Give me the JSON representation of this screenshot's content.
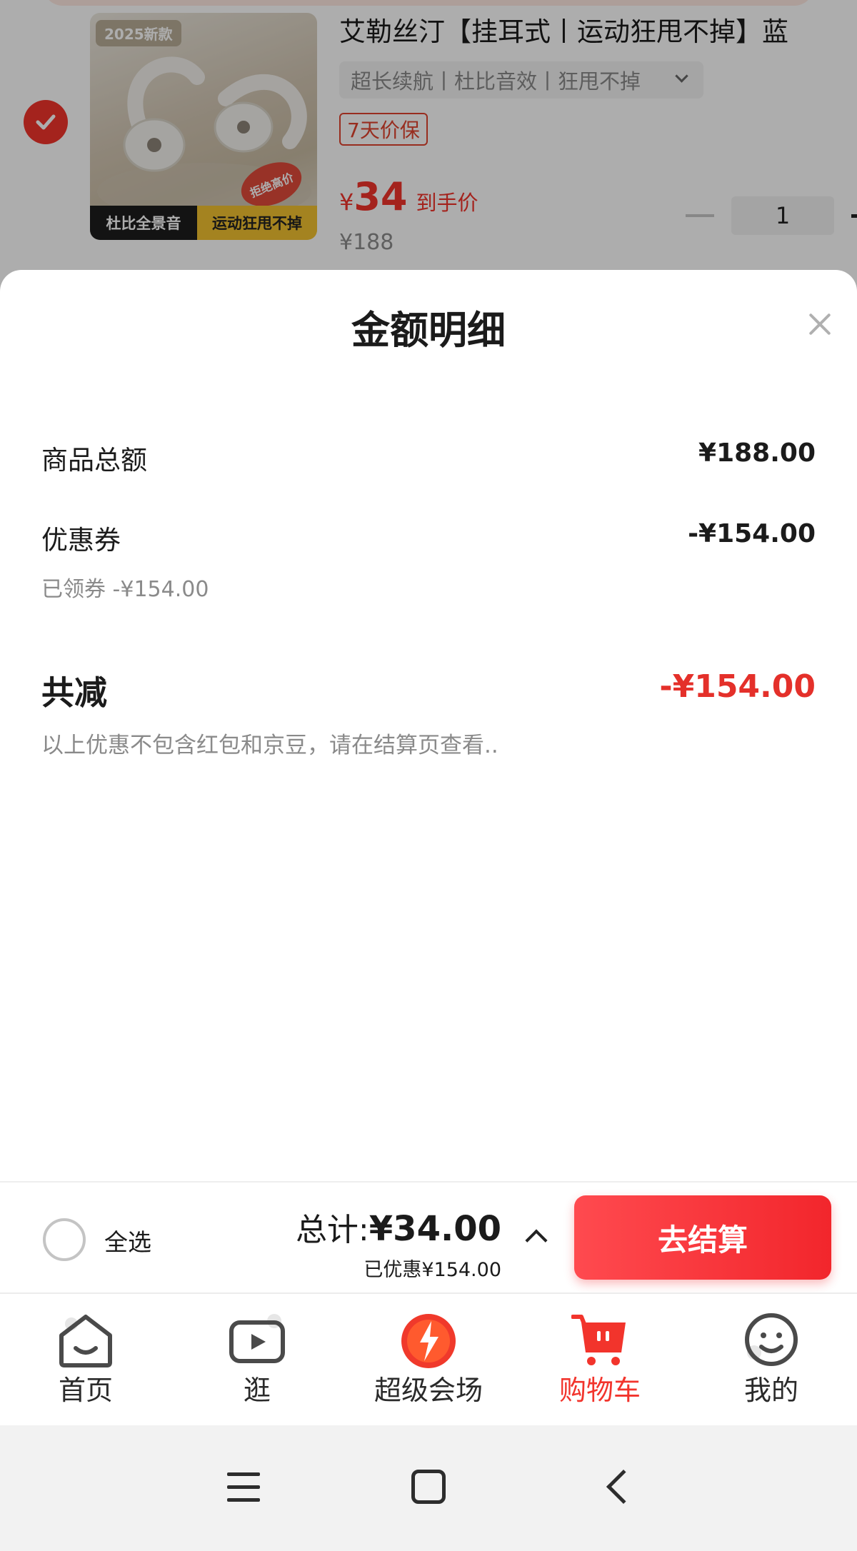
{
  "cart_item": {
    "image_badge_new": "2025新款",
    "image_stamp": "拒绝高价",
    "image_tag_left": "杜比全景音",
    "image_tag_right": "运动狂甩不掉",
    "title": "艾勒丝汀【挂耳式丨运动狂甩不掉】蓝",
    "spec": "超长续航丨杜比音效丨狂甩不掉",
    "badge": "7天价保",
    "price_symbol": "¥",
    "price": "34",
    "price_label": "到手价",
    "original_price": "¥188",
    "quantity": "1",
    "checked": true
  },
  "sheet": {
    "title": "金额明细",
    "rows": [
      {
        "label": "商品总额",
        "value": "¥188.00"
      },
      {
        "label": "优惠券",
        "value": "-¥154.00",
        "sub": "已领券 -¥154.00"
      }
    ],
    "total_label": "共减",
    "total_value": "-¥154.00",
    "note": "以上优惠不包含红包和京豆，请在结算页查看.."
  },
  "checkout": {
    "select_all_label": "全选",
    "total_label": "总计:",
    "total_value": "¥34.00",
    "saved_text": "已优惠¥154.00",
    "button_label": "去结算"
  },
  "tabs": [
    {
      "label": "首页",
      "icon": "home-icon"
    },
    {
      "label": "逛",
      "icon": "video-icon"
    },
    {
      "label": "超级会场",
      "icon": "super-venue-icon"
    },
    {
      "label": "购物车",
      "icon": "cart-icon",
      "active": true
    },
    {
      "label": "我的",
      "icon": "profile-icon"
    }
  ],
  "colors": {
    "accent": "#f2342c",
    "total_red": "#e4302a",
    "muted_text": "#8a8a8a"
  }
}
